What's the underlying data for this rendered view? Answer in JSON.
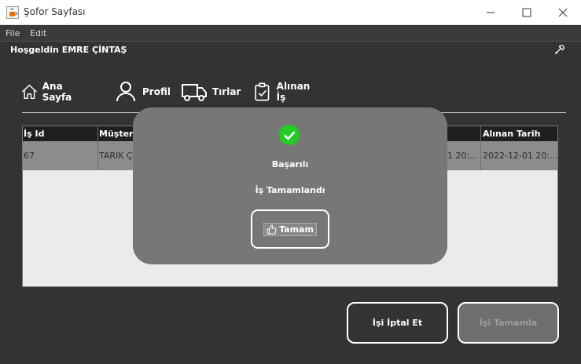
{
  "window": {
    "title": "Şofor Sayfası",
    "icon": "java-cup-icon",
    "controls": [
      "minimize-icon",
      "maximize-icon",
      "close-icon"
    ]
  },
  "menu": {
    "file": "File",
    "edit": "Edit"
  },
  "header": {
    "welcome": "Hoşgeldin EMRE ÇİNTAŞ",
    "settings_icon": "wrench-icon"
  },
  "nav": {
    "home": {
      "label": "Ana Sayfa",
      "icon": "home-icon"
    },
    "profile": {
      "label": "Profil",
      "icon": "user-icon"
    },
    "trucks": {
      "label": "Tırlar",
      "icon": "truck-icon"
    },
    "jobs": {
      "label": "Alınan İş",
      "icon": "clipboard-check-icon"
    }
  },
  "table": {
    "columns": {
      "id": "İş Id",
      "customer": "Müşteri",
      "date_partial": "",
      "taken_date": "Alınan Tarih"
    },
    "row": {
      "id": "67",
      "customer": "TARIK Ç",
      "date_partial": "01 20:...",
      "taken_date": "2022-12-01 20:..."
    }
  },
  "actions": {
    "cancel": "İşi İptal Et",
    "complete": "İşi Tamamla"
  },
  "dialog": {
    "icon": "check-circle-icon",
    "title": "Başarılı",
    "message": "İş Tamamlandı",
    "ok": "Tamam",
    "ok_icon": "thumbs-up-icon"
  },
  "colors": {
    "background": "#333333",
    "dialog": "#777777",
    "success": "#22cc22",
    "table_row": "#8c8c8c"
  }
}
